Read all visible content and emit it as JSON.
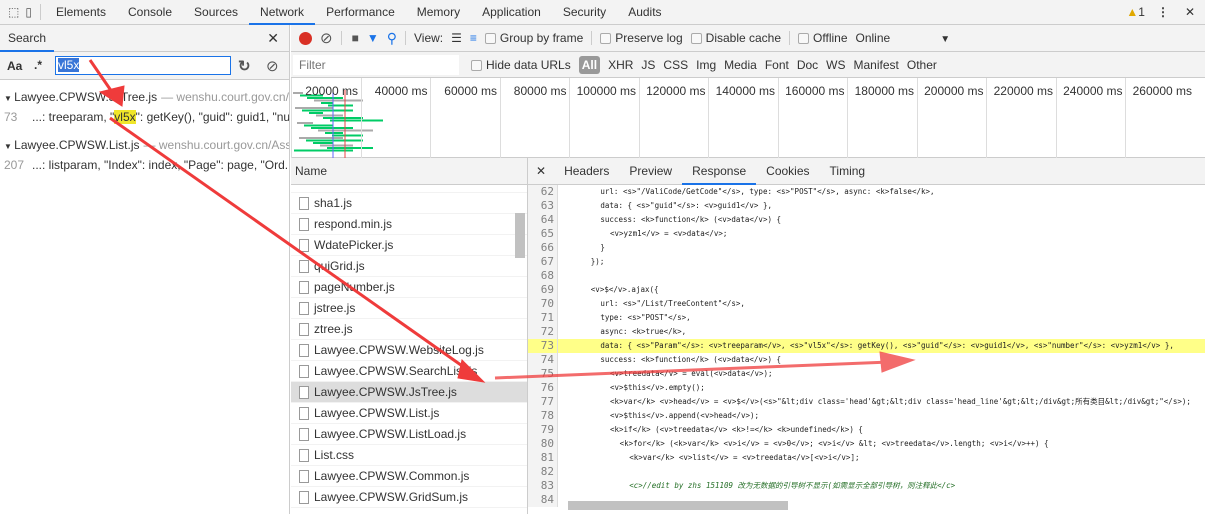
{
  "tabs": [
    "Elements",
    "Console",
    "Sources",
    "Network",
    "Performance",
    "Memory",
    "Application",
    "Security",
    "Audits"
  ],
  "active_tab": "Network",
  "warning_count": "1",
  "search": {
    "title": "Search",
    "case_label": "Aa",
    "regex_label": ".*",
    "query": "vl5x",
    "results": [
      {
        "file": "Lawyee.CPWSW.JsTree.js",
        "origin": "— wenshu.court.gov.cn/...",
        "line": "73",
        "pre": "...: treeparam, \"",
        "match": "vl5x",
        "post": "\": getKey(), \"guid\": guid1, \"nu..."
      },
      {
        "file": "Lawyee.CPWSW.List.js",
        "origin": "— wenshu.court.gov.cn/Ass...",
        "line": "207",
        "pre": "...: listparam, \"Index\": index, \"Page\": page, \"Ord...",
        "match": "",
        "post": ""
      }
    ]
  },
  "toolbar": {
    "view_label": "View:",
    "group_by_frame": "Group by frame",
    "preserve_log": "Preserve log",
    "disable_cache": "Disable cache",
    "offline": "Offline",
    "throttle": "Online"
  },
  "filter": {
    "placeholder": "Filter",
    "hide_data_urls": "Hide data URLs",
    "types": [
      "All",
      "XHR",
      "JS",
      "CSS",
      "Img",
      "Media",
      "Font",
      "Doc",
      "WS",
      "Manifest",
      "Other"
    ]
  },
  "timeline_ticks": [
    "20000 ms",
    "40000 ms",
    "60000 ms",
    "80000 ms",
    "100000 ms",
    "120000 ms",
    "140000 ms",
    "160000 ms",
    "180000 ms",
    "200000 ms",
    "220000 ms",
    "240000 ms",
    "260000 ms"
  ],
  "requests": {
    "header": "Name",
    "selected": "Lawyee.CPWSW.JsTree.js",
    "items": [
      "sha1.js",
      "respond.min.js",
      "WdatePicker.js",
      "quiGrid.js",
      "pageNumber.js",
      "jstree.js",
      "ztree.js",
      "Lawyee.CPWSW.WebsiteLog.js",
      "Lawyee.CPWSW.SearchList.js",
      "Lawyee.CPWSW.JsTree.js",
      "Lawyee.CPWSW.List.js",
      "Lawyee.CPWSW.ListLoad.js",
      "List.css",
      "Lawyee.CPWSW.Common.js",
      "Lawyee.CPWSW.GridSum.js"
    ]
  },
  "detail_tabs": [
    "Headers",
    "Preview",
    "Response",
    "Cookies",
    "Timing"
  ],
  "active_detail_tab": "Response",
  "highlighted_line": "73",
  "code": [
    {
      "n": "62",
      "h": "                url: <s>\"/ValiCode/GetCode\"</s>, type: <s>\"POST\"</s>, async: <k>false</k>,"
    },
    {
      "n": "63",
      "h": "                data: { <s>\"guid\"</s>: <v>guid1</v> },"
    },
    {
      "n": "64",
      "h": "                success: <k>function</k> (<v>data</v>) {"
    },
    {
      "n": "65",
      "h": "                    <v>yzm1</v> = <v>data</v>;"
    },
    {
      "n": "66",
      "h": "                }"
    },
    {
      "n": "67",
      "h": "            });"
    },
    {
      "n": "68",
      "h": ""
    },
    {
      "n": "69",
      "h": "            <v>$</v>.ajax({"
    },
    {
      "n": "70",
      "h": "                url: <s>\"/List/TreeContent\"</s>,"
    },
    {
      "n": "71",
      "h": "                type: <s>\"POST\"</s>,"
    },
    {
      "n": "72",
      "h": "                async: <k>true</k>,"
    },
    {
      "n": "73",
      "h": "                data: { <s>\"Param\"</s>: <v>treeparam</v>, <s>\"vl5x\"</s>: getKey(), <s>\"guid\"</s>: <v>guid1</v>, <s>\"number\"</s>: <v>yzm1</v> },"
    },
    {
      "n": "74",
      "h": "                success: <k>function</k> (<v>data</v>) {"
    },
    {
      "n": "75",
      "h": "                    <v>treedata</v> = eval(<v>data</v>);"
    },
    {
      "n": "76",
      "h": "                    <v>$this</v>.empty();"
    },
    {
      "n": "77",
      "h": "                    <k>var</k> <v>head</v> = <v>$</v>(<s>\"&lt;div class='head'&gt;&lt;div class='head_line'&gt;&lt;/div&gt;所有类目&lt;/div&gt;\"</s>);"
    },
    {
      "n": "78",
      "h": "                    <v>$this</v>.append(<v>head</v>);"
    },
    {
      "n": "79",
      "h": "                    <k>if</k> (<v>treedata</v> <k>!=</k> <k>undefined</k>) {"
    },
    {
      "n": "80",
      "h": "                        <k>for</k> (<k>var</k> <v>i</v> = <v>0</v>; <v>i</v> &lt; <v>treedata</v>.length; <v>i</v>++) {"
    },
    {
      "n": "81",
      "h": "                            <k>var</k> <v>list</v> = <v>treedata</v>[<v>i</v>];"
    },
    {
      "n": "82",
      "h": ""
    },
    {
      "n": "83",
      "h": "                            <c>//edit by zhs 151109 改为无数据的引导树不显示(如需显示全部引导树，则注释此</c>"
    },
    {
      "n": "84",
      "h": ""
    }
  ],
  "colors": {
    "accent": "#1a73e8",
    "record": "#d93025",
    "highlight": "#ffff88",
    "arrow": "#ef3b3b"
  }
}
